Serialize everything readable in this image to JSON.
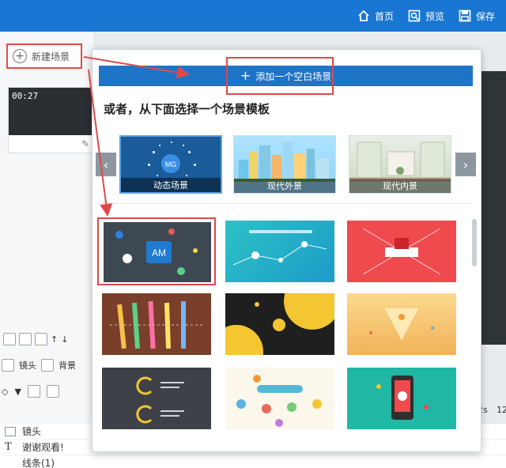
{
  "topbar": {
    "home_label": "首页",
    "preview_label": "预览",
    "save_label": "保存",
    "background": "#1976d2"
  },
  "left_panel": {
    "new_scene_label": "新建场景",
    "thumb_time": "00:27",
    "tabs": [
      "镜头",
      "背景"
    ],
    "list_rows": [
      "镜头",
      "谢谢观看!",
      "线条(1)"
    ]
  },
  "popup": {
    "add_blank_label": "添加一个空白场景",
    "or_choose_text": "或者，从下面选择一个场景模板",
    "categories": [
      {
        "label": "动态场景"
      },
      {
        "label": "现代外景"
      },
      {
        "label": "现代内景"
      }
    ],
    "templates": [
      {
        "label": "AM"
      },
      {
        "label": ""
      },
      {
        "label": ""
      },
      {
        "label": ""
      },
      {
        "label": ""
      },
      {
        "label": ""
      },
      {
        "label": ""
      },
      {
        "label": ""
      },
      {
        "label": ""
      }
    ]
  },
  "timeline": {
    "ticks": [
      "2s",
      "12"
    ]
  },
  "colors": {
    "accent": "#1e74c7",
    "annotation": "#e04848"
  }
}
